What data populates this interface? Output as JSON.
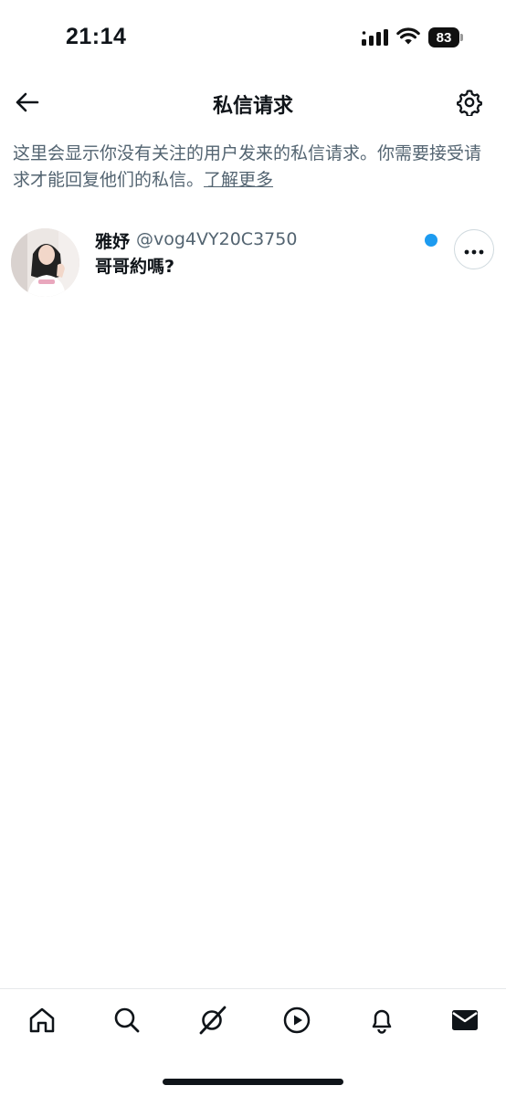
{
  "status_bar": {
    "time": "21:14",
    "battery_level": "83",
    "icons": [
      "signal-icon",
      "wifi-icon",
      "battery-icon"
    ]
  },
  "header": {
    "title": "私信请求",
    "back_icon": "arrow-left-icon",
    "settings_icon": "gear-icon"
  },
  "info": {
    "text": "这里会显示你没有关注的用户发来的私信请求。你需要接受请求才能回复他们的私信。",
    "learn_more": "了解更多"
  },
  "requests": [
    {
      "name": "雅妤",
      "handle": "@vog4VY20C3750",
      "preview": "哥哥約嗎?",
      "unread": true,
      "unread_color": "#1d9bf0"
    }
  ],
  "bottom_nav": {
    "items": [
      "home-icon",
      "search-icon",
      "grok-icon",
      "video-icon",
      "notifications-icon",
      "messages-icon"
    ],
    "active": "messages-icon"
  },
  "colors": {
    "text_primary": "#0f1419",
    "text_secondary": "#536471",
    "accent": "#1d9bf0"
  }
}
